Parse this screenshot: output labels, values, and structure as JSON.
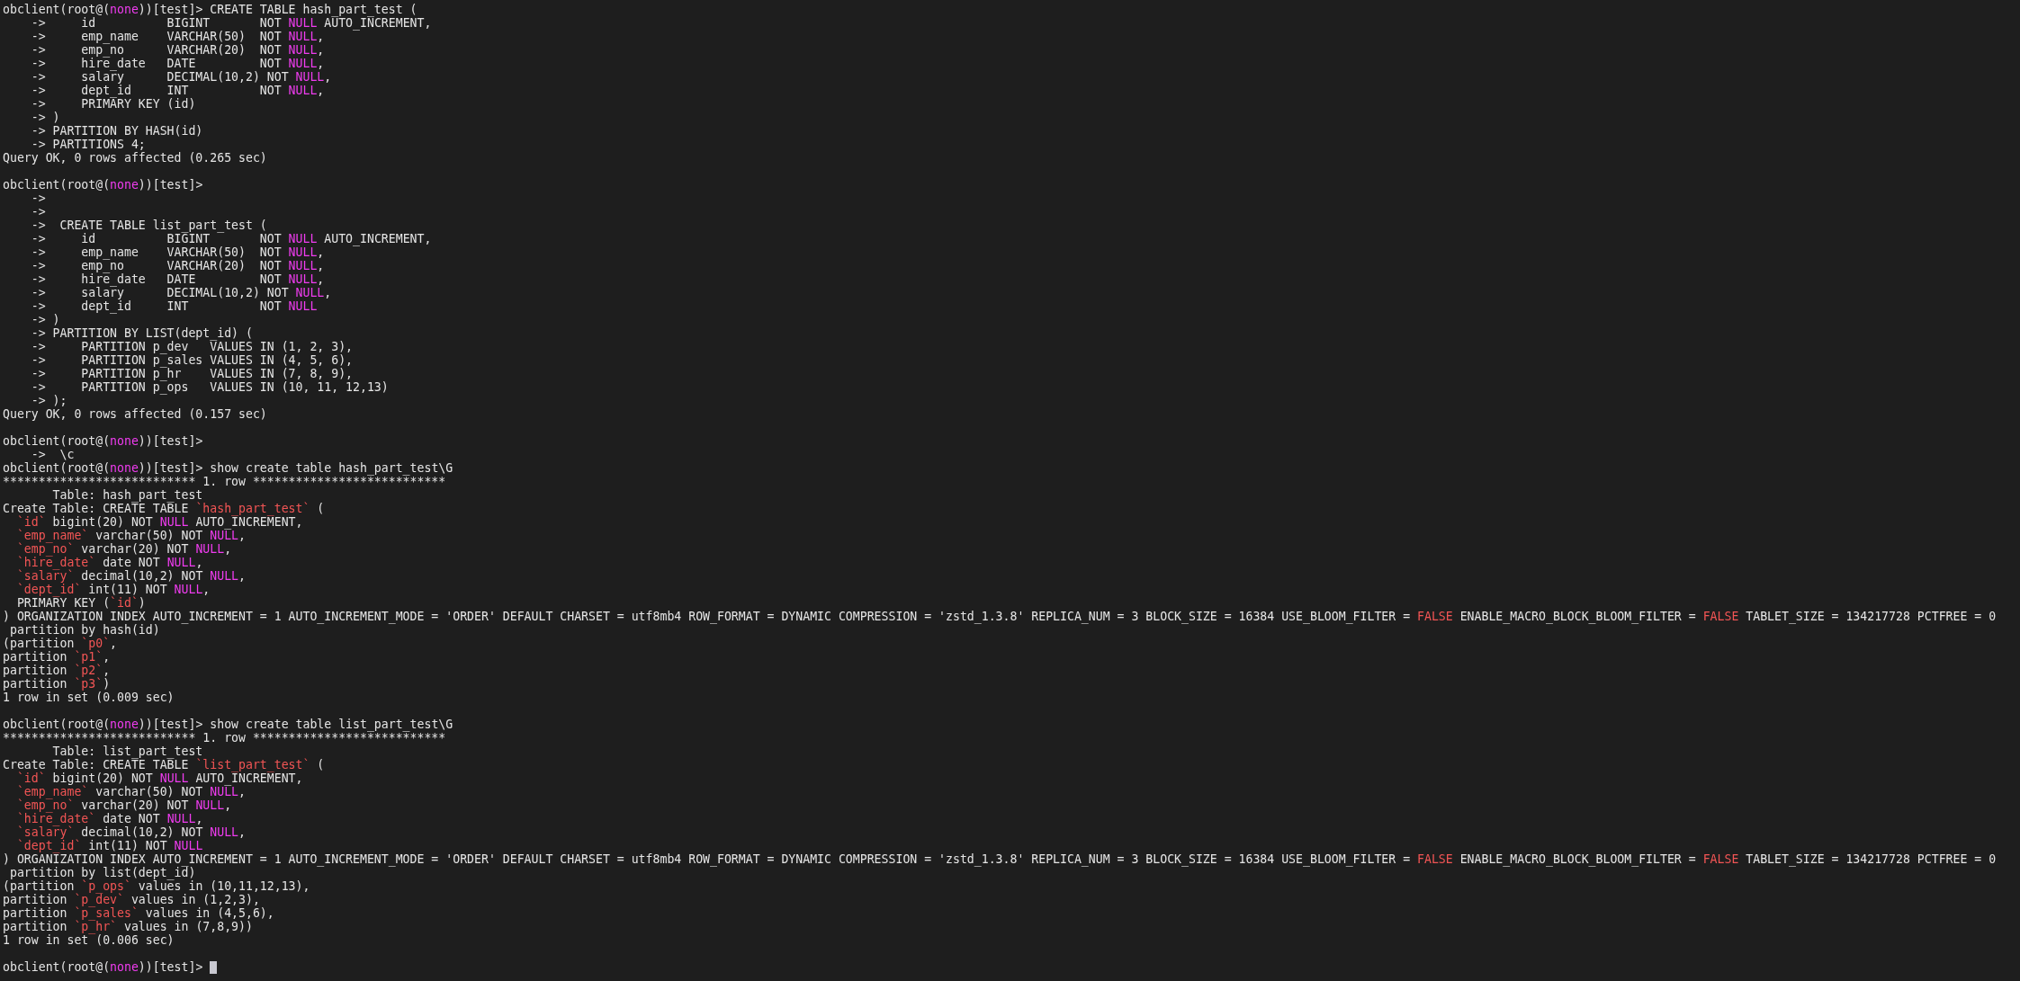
{
  "terminal": {
    "lines": [
      {
        "kind": "text",
        "segments": [
          {
            "text": "obclient(root@("
          },
          {
            "text": "none",
            "color": "#f03cf0"
          },
          {
            "text": "))[test]> CREATE TABLE hash_part_test ("
          }
        ]
      },
      {
        "kind": "text",
        "segments": [
          {
            "text": "    ->     id          BIGINT       NOT "
          },
          {
            "text": "NULL",
            "color": "#f03cf0"
          },
          {
            "text": " AUTO_INCREMENT,"
          }
        ]
      },
      {
        "kind": "text",
        "segments": [
          {
            "text": "    ->     emp_name    VARCHAR(50)  NOT "
          },
          {
            "text": "NULL",
            "color": "#f03cf0"
          },
          {
            "text": ","
          }
        ]
      },
      {
        "kind": "text",
        "segments": [
          {
            "text": "    ->     emp_no      VARCHAR(20)  NOT "
          },
          {
            "text": "NULL",
            "color": "#f03cf0"
          },
          {
            "text": ","
          }
        ]
      },
      {
        "kind": "text",
        "segments": [
          {
            "text": "    ->     hire_date   DATE         NOT "
          },
          {
            "text": "NULL",
            "color": "#f03cf0"
          },
          {
            "text": ","
          }
        ]
      },
      {
        "kind": "text",
        "segments": [
          {
            "text": "    ->     salary      DECIMAL(10,2) NOT "
          },
          {
            "text": "NULL",
            "color": "#f03cf0"
          },
          {
            "text": ","
          }
        ]
      },
      {
        "kind": "text",
        "segments": [
          {
            "text": "    ->     dept_id     INT          NOT "
          },
          {
            "text": "NULL",
            "color": "#f03cf0"
          },
          {
            "text": ","
          }
        ]
      },
      {
        "kind": "text",
        "segments": [
          {
            "text": "    ->     PRIMARY KEY (id)"
          }
        ]
      },
      {
        "kind": "text",
        "segments": [
          {
            "text": "    -> )"
          }
        ]
      },
      {
        "kind": "text",
        "segments": [
          {
            "text": "    -> PARTITION BY HASH(id)"
          }
        ]
      },
      {
        "kind": "text",
        "segments": [
          {
            "text": "    -> PARTITIONS 4;"
          }
        ]
      },
      {
        "kind": "text",
        "segments": [
          {
            "text": "Query OK, 0 rows affected (0.265 sec)"
          }
        ]
      },
      {
        "kind": "blank"
      },
      {
        "kind": "text",
        "segments": [
          {
            "text": "obclient(root@("
          },
          {
            "text": "none",
            "color": "#f03cf0"
          },
          {
            "text": "))[test]>"
          }
        ]
      },
      {
        "kind": "text",
        "segments": [
          {
            "text": "    ->"
          }
        ]
      },
      {
        "kind": "text",
        "segments": [
          {
            "text": "    ->"
          }
        ]
      },
      {
        "kind": "text",
        "segments": [
          {
            "text": "    ->  CREATE TABLE list_part_test ("
          }
        ]
      },
      {
        "kind": "text",
        "segments": [
          {
            "text": "    ->     id          BIGINT       NOT "
          },
          {
            "text": "NULL",
            "color": "#f03cf0"
          },
          {
            "text": " AUTO_INCREMENT,"
          }
        ]
      },
      {
        "kind": "text",
        "segments": [
          {
            "text": "    ->     emp_name    VARCHAR(50)  NOT "
          },
          {
            "text": "NULL",
            "color": "#f03cf0"
          },
          {
            "text": ","
          }
        ]
      },
      {
        "kind": "text",
        "segments": [
          {
            "text": "    ->     emp_no      VARCHAR(20)  NOT "
          },
          {
            "text": "NULL",
            "color": "#f03cf0"
          },
          {
            "text": ","
          }
        ]
      },
      {
        "kind": "text",
        "segments": [
          {
            "text": "    ->     hire_date   DATE         NOT "
          },
          {
            "text": "NULL",
            "color": "#f03cf0"
          },
          {
            "text": ","
          }
        ]
      },
      {
        "kind": "text",
        "segments": [
          {
            "text": "    ->     salary      DECIMAL(10,2) NOT "
          },
          {
            "text": "NULL",
            "color": "#f03cf0"
          },
          {
            "text": ","
          }
        ]
      },
      {
        "kind": "text",
        "segments": [
          {
            "text": "    ->     dept_id     INT          NOT "
          },
          {
            "text": "NULL",
            "color": "#f03cf0"
          }
        ]
      },
      {
        "kind": "text",
        "segments": [
          {
            "text": "    -> )"
          }
        ]
      },
      {
        "kind": "text",
        "segments": [
          {
            "text": "    -> PARTITION BY LIST(dept_id) ("
          }
        ]
      },
      {
        "kind": "text",
        "segments": [
          {
            "text": "    ->     PARTITION p_dev   VALUES IN (1, 2, 3),"
          }
        ]
      },
      {
        "kind": "text",
        "segments": [
          {
            "text": "    ->     PARTITION p_sales VALUES IN (4, 5, 6),"
          }
        ]
      },
      {
        "kind": "text",
        "segments": [
          {
            "text": "    ->     PARTITION p_hr    VALUES IN (7, 8, 9),"
          }
        ]
      },
      {
        "kind": "text",
        "segments": [
          {
            "text": "    ->     PARTITION p_ops   VALUES IN (10, 11, 12,13)"
          }
        ]
      },
      {
        "kind": "text",
        "segments": [
          {
            "text": "    -> );"
          }
        ]
      },
      {
        "kind": "text",
        "segments": [
          {
            "text": "Query OK, 0 rows affected (0.157 sec)"
          }
        ]
      },
      {
        "kind": "blank"
      },
      {
        "kind": "text",
        "segments": [
          {
            "text": "obclient(root@("
          },
          {
            "text": "none",
            "color": "#f03cf0"
          },
          {
            "text": "))[test]>"
          }
        ]
      },
      {
        "kind": "text",
        "segments": [
          {
            "text": "    ->  \\c"
          }
        ]
      },
      {
        "kind": "text",
        "segments": [
          {
            "text": "obclient(root@("
          },
          {
            "text": "none",
            "color": "#f03cf0"
          },
          {
            "text": "))[test]> show create table hash_part_test\\G"
          }
        ]
      },
      {
        "kind": "text",
        "segments": [
          {
            "text": "*************************** 1. row ***************************"
          }
        ]
      },
      {
        "kind": "text",
        "segments": [
          {
            "text": "       Table: hash_part_test"
          }
        ]
      },
      {
        "kind": "text",
        "segments": [
          {
            "text": "Create Table: CREATE TABLE "
          },
          {
            "text": "`hash_part_test`",
            "color": "#f25555"
          },
          {
            "text": " ("
          }
        ]
      },
      {
        "kind": "text",
        "segments": [
          {
            "text": "  `id`",
            "color": "#f25555"
          },
          {
            "text": " bigint(20) NOT "
          },
          {
            "text": "NULL",
            "color": "#f03cf0"
          },
          {
            "text": " AUTO_INCREMENT,"
          }
        ]
      },
      {
        "kind": "text",
        "segments": [
          {
            "text": "  `emp_name`",
            "color": "#f25555"
          },
          {
            "text": " varchar(50) NOT "
          },
          {
            "text": "NULL",
            "color": "#f03cf0"
          },
          {
            "text": ","
          }
        ]
      },
      {
        "kind": "text",
        "segments": [
          {
            "text": "  `emp_no`",
            "color": "#f25555"
          },
          {
            "text": " varchar(20) NOT "
          },
          {
            "text": "NULL",
            "color": "#f03cf0"
          },
          {
            "text": ","
          }
        ]
      },
      {
        "kind": "text",
        "segments": [
          {
            "text": "  `hire_date`",
            "color": "#f25555"
          },
          {
            "text": " date NOT "
          },
          {
            "text": "NULL",
            "color": "#f03cf0"
          },
          {
            "text": ","
          }
        ]
      },
      {
        "kind": "text",
        "segments": [
          {
            "text": "  `salary`",
            "color": "#f25555"
          },
          {
            "text": " decimal(10,2) NOT "
          },
          {
            "text": "NULL",
            "color": "#f03cf0"
          },
          {
            "text": ","
          }
        ]
      },
      {
        "kind": "text",
        "segments": [
          {
            "text": "  `dept_id`",
            "color": "#f25555"
          },
          {
            "text": " int(11) NOT "
          },
          {
            "text": "NULL",
            "color": "#f03cf0"
          },
          {
            "text": ","
          }
        ]
      },
      {
        "kind": "text",
        "segments": [
          {
            "text": "  PRIMARY KEY ("
          },
          {
            "text": "`id`",
            "color": "#f25555"
          },
          {
            "text": ")"
          }
        ]
      },
      {
        "kind": "text",
        "segments": [
          {
            "text": ") ORGANIZATION INDEX AUTO_INCREMENT = 1 AUTO_INCREMENT_MODE = 'ORDER' DEFAULT CHARSET = utf8mb4 ROW_FORMAT = DYNAMIC COMPRESSION = 'zstd_1.3.8' REPLICA_NUM = 3 BLOCK_SIZE = 16384 USE_BLOOM_FILTER = "
          },
          {
            "text": "FALSE",
            "color": "#f25555"
          },
          {
            "text": " ENABLE_MACRO_BLOCK_BLOOM_FILTER = "
          },
          {
            "text": "FALSE",
            "color": "#f25555"
          },
          {
            "text": " TABLET_SIZE = 134217728 PCTFREE = 0"
          }
        ]
      },
      {
        "kind": "text",
        "segments": [
          {
            "text": " partition by hash(id)"
          }
        ]
      },
      {
        "kind": "text",
        "segments": [
          {
            "text": "(partition "
          },
          {
            "text": "`p0`",
            "color": "#f25555"
          },
          {
            "text": ","
          }
        ]
      },
      {
        "kind": "text",
        "segments": [
          {
            "text": "partition "
          },
          {
            "text": "`p1`",
            "color": "#f25555"
          },
          {
            "text": ","
          }
        ]
      },
      {
        "kind": "text",
        "segments": [
          {
            "text": "partition "
          },
          {
            "text": "`p2`",
            "color": "#f25555"
          },
          {
            "text": ","
          }
        ]
      },
      {
        "kind": "text",
        "segments": [
          {
            "text": "partition "
          },
          {
            "text": "`p3`",
            "color": "#f25555"
          },
          {
            "text": ")"
          }
        ]
      },
      {
        "kind": "text",
        "segments": [
          {
            "text": "1 row in set (0.009 sec)"
          }
        ]
      },
      {
        "kind": "blank"
      },
      {
        "kind": "text",
        "segments": [
          {
            "text": "obclient(root@("
          },
          {
            "text": "none",
            "color": "#f03cf0"
          },
          {
            "text": "))[test]> show create table list_part_test\\G"
          }
        ]
      },
      {
        "kind": "text",
        "segments": [
          {
            "text": "*************************** 1. row ***************************"
          }
        ]
      },
      {
        "kind": "text",
        "segments": [
          {
            "text": "       Table: list_part_test"
          }
        ]
      },
      {
        "kind": "text",
        "segments": [
          {
            "text": "Create Table: CREATE TABLE "
          },
          {
            "text": "`list_part_test`",
            "color": "#f25555"
          },
          {
            "text": " ("
          }
        ]
      },
      {
        "kind": "text",
        "segments": [
          {
            "text": "  `id`",
            "color": "#f25555"
          },
          {
            "text": " bigint(20) NOT "
          },
          {
            "text": "NULL",
            "color": "#f03cf0"
          },
          {
            "text": " AUTO_INCREMENT,"
          }
        ]
      },
      {
        "kind": "text",
        "segments": [
          {
            "text": "  `emp_name`",
            "color": "#f25555"
          },
          {
            "text": " varchar(50) NOT "
          },
          {
            "text": "NULL",
            "color": "#f03cf0"
          },
          {
            "text": ","
          }
        ]
      },
      {
        "kind": "text",
        "segments": [
          {
            "text": "  `emp_no`",
            "color": "#f25555"
          },
          {
            "text": " varchar(20) NOT "
          },
          {
            "text": "NULL",
            "color": "#f03cf0"
          },
          {
            "text": ","
          }
        ]
      },
      {
        "kind": "text",
        "segments": [
          {
            "text": "  `hire_date`",
            "color": "#f25555"
          },
          {
            "text": " date NOT "
          },
          {
            "text": "NULL",
            "color": "#f03cf0"
          },
          {
            "text": ","
          }
        ]
      },
      {
        "kind": "text",
        "segments": [
          {
            "text": "  `salary`",
            "color": "#f25555"
          },
          {
            "text": " decimal(10,2) NOT "
          },
          {
            "text": "NULL",
            "color": "#f03cf0"
          },
          {
            "text": ","
          }
        ]
      },
      {
        "kind": "text",
        "segments": [
          {
            "text": "  `dept_id`",
            "color": "#f25555"
          },
          {
            "text": " int(11) NOT "
          },
          {
            "text": "NULL",
            "color": "#f03cf0"
          }
        ]
      },
      {
        "kind": "text",
        "segments": [
          {
            "text": ") ORGANIZATION INDEX AUTO_INCREMENT = 1 AUTO_INCREMENT_MODE = 'ORDER' DEFAULT CHARSET = utf8mb4 ROW_FORMAT = DYNAMIC COMPRESSION = 'zstd_1.3.8' REPLICA_NUM = 3 BLOCK_SIZE = 16384 USE_BLOOM_FILTER = "
          },
          {
            "text": "FALSE",
            "color": "#f25555"
          },
          {
            "text": " ENABLE_MACRO_BLOCK_BLOOM_FILTER = "
          },
          {
            "text": "FALSE",
            "color": "#f25555"
          },
          {
            "text": " TABLET_SIZE = 134217728 PCTFREE = 0"
          }
        ]
      },
      {
        "kind": "text",
        "segments": [
          {
            "text": " partition by list(dept_id)"
          }
        ]
      },
      {
        "kind": "text",
        "segments": [
          {
            "text": "(partition "
          },
          {
            "text": "`p_ops`",
            "color": "#f25555"
          },
          {
            "text": " values in (10,11,12,13),"
          }
        ]
      },
      {
        "kind": "text",
        "segments": [
          {
            "text": "partition "
          },
          {
            "text": "`p_dev`",
            "color": "#f25555"
          },
          {
            "text": " values in (1,2,3),"
          }
        ]
      },
      {
        "kind": "text",
        "segments": [
          {
            "text": "partition "
          },
          {
            "text": "`p_sales`",
            "color": "#f25555"
          },
          {
            "text": " values in (4,5,6),"
          }
        ]
      },
      {
        "kind": "text",
        "segments": [
          {
            "text": "partition "
          },
          {
            "text": "`p_hr`",
            "color": "#f25555"
          },
          {
            "text": " values in (7,8,9))"
          }
        ]
      },
      {
        "kind": "text",
        "segments": [
          {
            "text": "1 row in set (0.006 sec)"
          }
        ]
      },
      {
        "kind": "blank"
      },
      {
        "kind": "prompt",
        "segments": [
          {
            "text": "obclient(root@("
          },
          {
            "text": "none",
            "color": "#f03cf0"
          },
          {
            "text": "))[test]> "
          }
        ]
      }
    ]
  }
}
